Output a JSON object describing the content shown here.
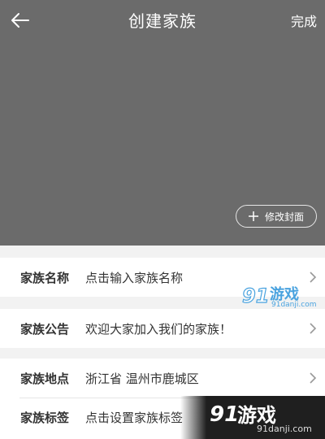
{
  "header": {
    "title": "创建家族",
    "done_label": "完成"
  },
  "cover": {
    "button_label": "修改封面"
  },
  "sections": {
    "name": {
      "label": "家族名称",
      "value": "点击输入家族名称"
    },
    "notice": {
      "label": "家族公告",
      "value": "欢迎大家加入我们的家族！"
    },
    "location": {
      "label": "家族地点",
      "value": "浙江省 温州市鹿城区"
    },
    "tags": {
      "label": "家族标签",
      "value": "点击设置家族标签"
    }
  },
  "watermark": {
    "small_brand": "游戏",
    "small_domain": "91danji.com",
    "big_brand": "游戏",
    "big_domain": "91danji.com",
    "logo_text": "91"
  },
  "colors": {
    "cover": "#6b6b6b",
    "background": "#f2f2f2",
    "text": "#333333",
    "watermark_blue": "#4aa3df"
  }
}
